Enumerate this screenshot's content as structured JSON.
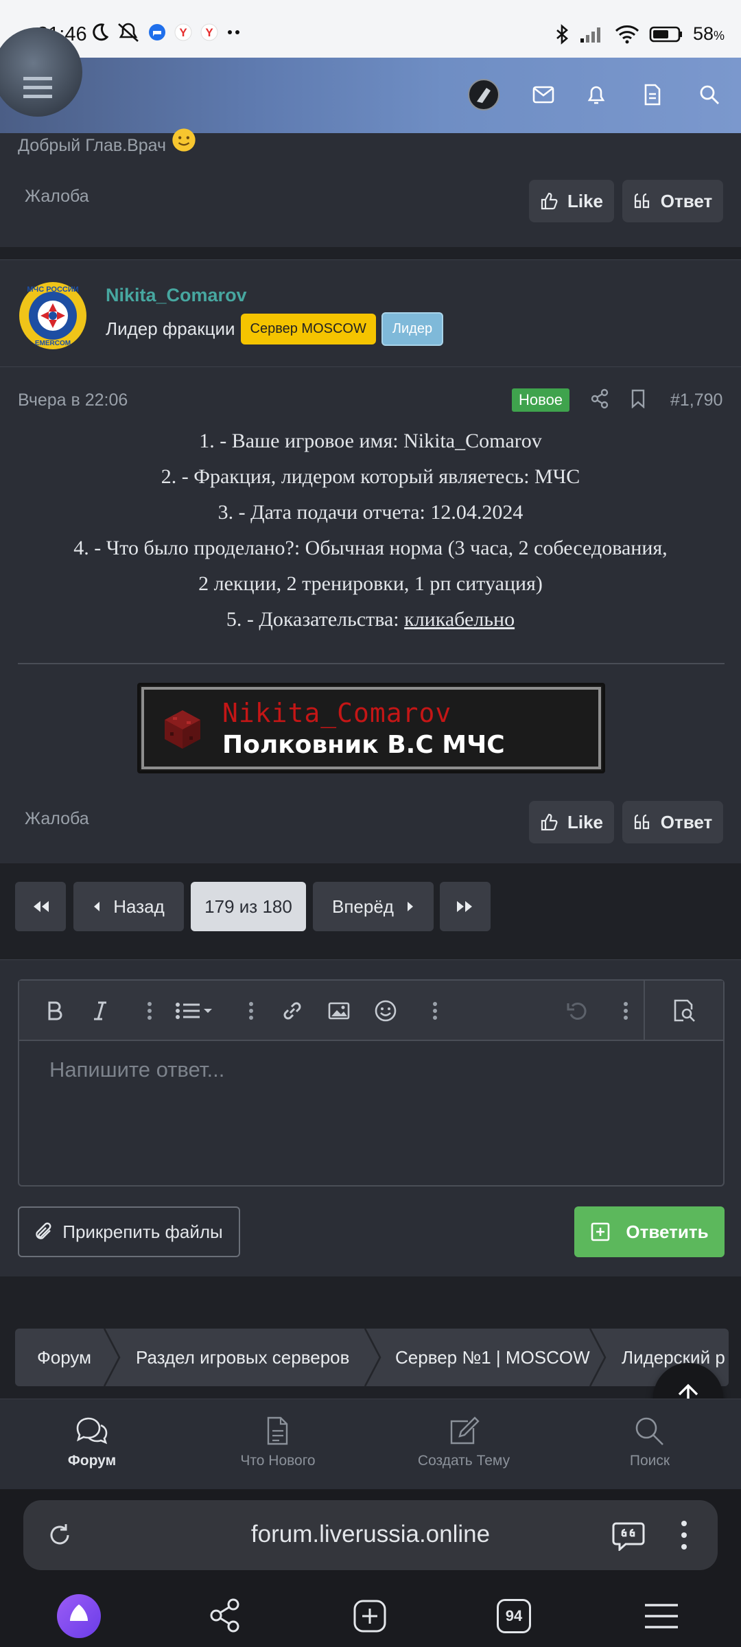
{
  "status_bar": {
    "time": "21:46",
    "battery": "58",
    "battery_unit": "%"
  },
  "prev_post": {
    "text_tail": "Добрый Глав.Врач",
    "complaint": "Жалоба",
    "like": "Like",
    "reply": "Ответ"
  },
  "post": {
    "username": "Nikita_Comarov",
    "user_title": "Лидер фракции",
    "badge_server": "Сервер MOSCOW",
    "badge_leader": "Лидер",
    "date": "Вчера в 22:06",
    "new_badge": "Новое",
    "post_number": "#1,790",
    "lines": [
      "1. - Ваше игровое имя: Nikita_Comarov",
      "2. - Фракция, лидером который являетесь: МЧС",
      "3. - Дата подачи отчета: 12.04.2024",
      "4. - Что было проделано?: Обычная норма (3 часа, 2 собеседования,",
      "2 лекции, 2 тренировки, 1 рп ситуация)"
    ],
    "evidence_label": "5. - Доказательства: ",
    "evidence_link": "кликабельно",
    "signature_name": "Nikita_Comarov",
    "signature_rank": "Полковник В.С МЧС",
    "complaint": "Жалоба",
    "like": "Like",
    "reply": "Ответ"
  },
  "pagination": {
    "prev": "Назад",
    "current": "179 из 180",
    "next": "Вперёд"
  },
  "editor": {
    "placeholder": "Напишите ответ...",
    "attach": "Прикрепить файлы",
    "submit": "Ответить"
  },
  "breadcrumbs": [
    "Форум",
    "Раздел игровых серверов",
    "Сервер №1 | MOSCOW",
    "Лидерский р"
  ],
  "bottom_nav": [
    {
      "label": "Форум",
      "icon": "chat-bubbles-icon",
      "active": true
    },
    {
      "label": "Что Нового",
      "icon": "document-icon",
      "active": false
    },
    {
      "label": "Создать Тему",
      "icon": "edit-icon",
      "active": false
    },
    {
      "label": "Поиск",
      "icon": "search-icon",
      "active": false
    }
  ],
  "browser": {
    "url": "forum.liverussia.online",
    "tabs_count": "94"
  },
  "colors": {
    "accent_green": "#5cb85c",
    "badge_yellow": "#f5c400",
    "badge_blue": "#7fb9d9",
    "username_teal": "#47a7a0",
    "signature_red": "#c41616"
  }
}
